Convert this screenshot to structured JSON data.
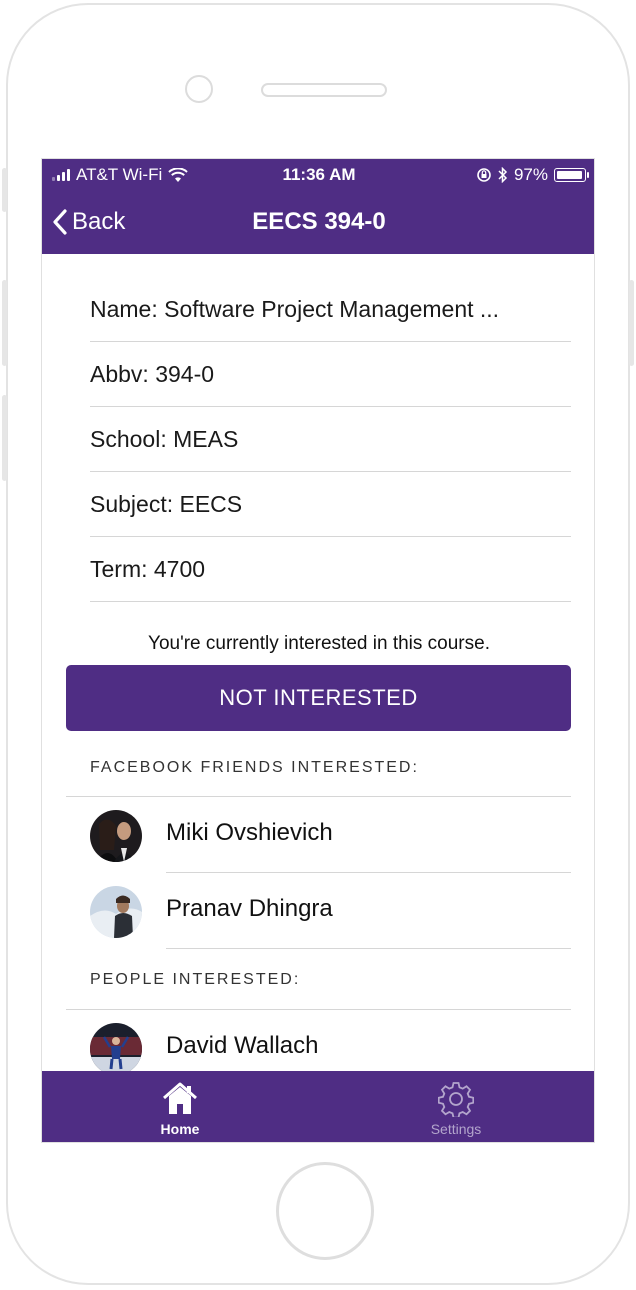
{
  "status_bar": {
    "carrier": "AT&T Wi-Fi",
    "time": "11:36 AM",
    "battery": "97%",
    "battery_level": 0.97
  },
  "nav": {
    "back_label": "Back",
    "title": "EECS 394-0"
  },
  "course_info": [
    "Name: Software Project Management ...",
    "Abbv: 394-0",
    "School: MEAS",
    "Subject: EECS",
    "Term: 4700"
  ],
  "interest": {
    "message": "You're currently interested in this course.",
    "button_label": "NOT INTERESTED"
  },
  "friends_section": {
    "header": "FACEBOOK FRIENDS INTERESTED:",
    "people": [
      "Miki Ovshievich",
      "Pranav Dhingra"
    ]
  },
  "people_section": {
    "header": "PEOPLE INTERESTED:",
    "people": [
      "David Wallach"
    ]
  },
  "tabs": [
    {
      "label": "Home",
      "icon": "home-icon",
      "active": true
    },
    {
      "label": "Settings",
      "icon": "gear-icon",
      "active": false
    }
  ],
  "colors": {
    "brand_purple": "#4f2d84",
    "active_tab": "#ffffff",
    "inactive_tab": "#b3a5cc"
  }
}
